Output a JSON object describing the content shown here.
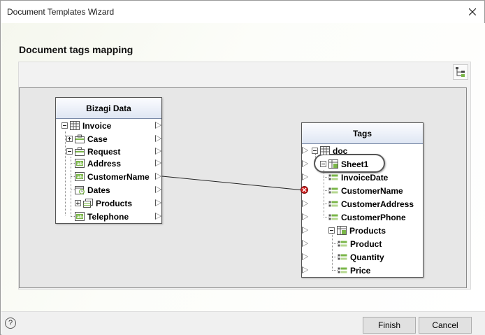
{
  "window": {
    "title": "Document Templates Wizard"
  },
  "section": {
    "title": "Document tags mapping"
  },
  "source": {
    "header": "Bizagi Data",
    "nodes": [
      {
        "label": "Invoice"
      },
      {
        "label": "Case"
      },
      {
        "label": "Request"
      },
      {
        "label": "Address"
      },
      {
        "label": "CustomerName"
      },
      {
        "label": "Dates"
      },
      {
        "label": "Products"
      },
      {
        "label": "Telephone"
      }
    ]
  },
  "target": {
    "header": "Tags",
    "nodes": [
      {
        "label": "doc"
      },
      {
        "label": "Sheet1"
      },
      {
        "label": "InvoiceDate"
      },
      {
        "label": "CustomerName"
      },
      {
        "label": "CustomerAddress"
      },
      {
        "label": "CustomerPhone"
      },
      {
        "label": "Products"
      },
      {
        "label": "Product"
      },
      {
        "label": "Quantity"
      },
      {
        "label": "Price"
      }
    ]
  },
  "mapping": {
    "from": "CustomerName",
    "to": "CustomerName"
  },
  "footer": {
    "help": "?",
    "finish": "Finish",
    "cancel": "Cancel"
  },
  "colors": {
    "accent_green": "#7ab648",
    "header_blue": "#dfe6f3",
    "connector_error": "#d01f1f"
  }
}
